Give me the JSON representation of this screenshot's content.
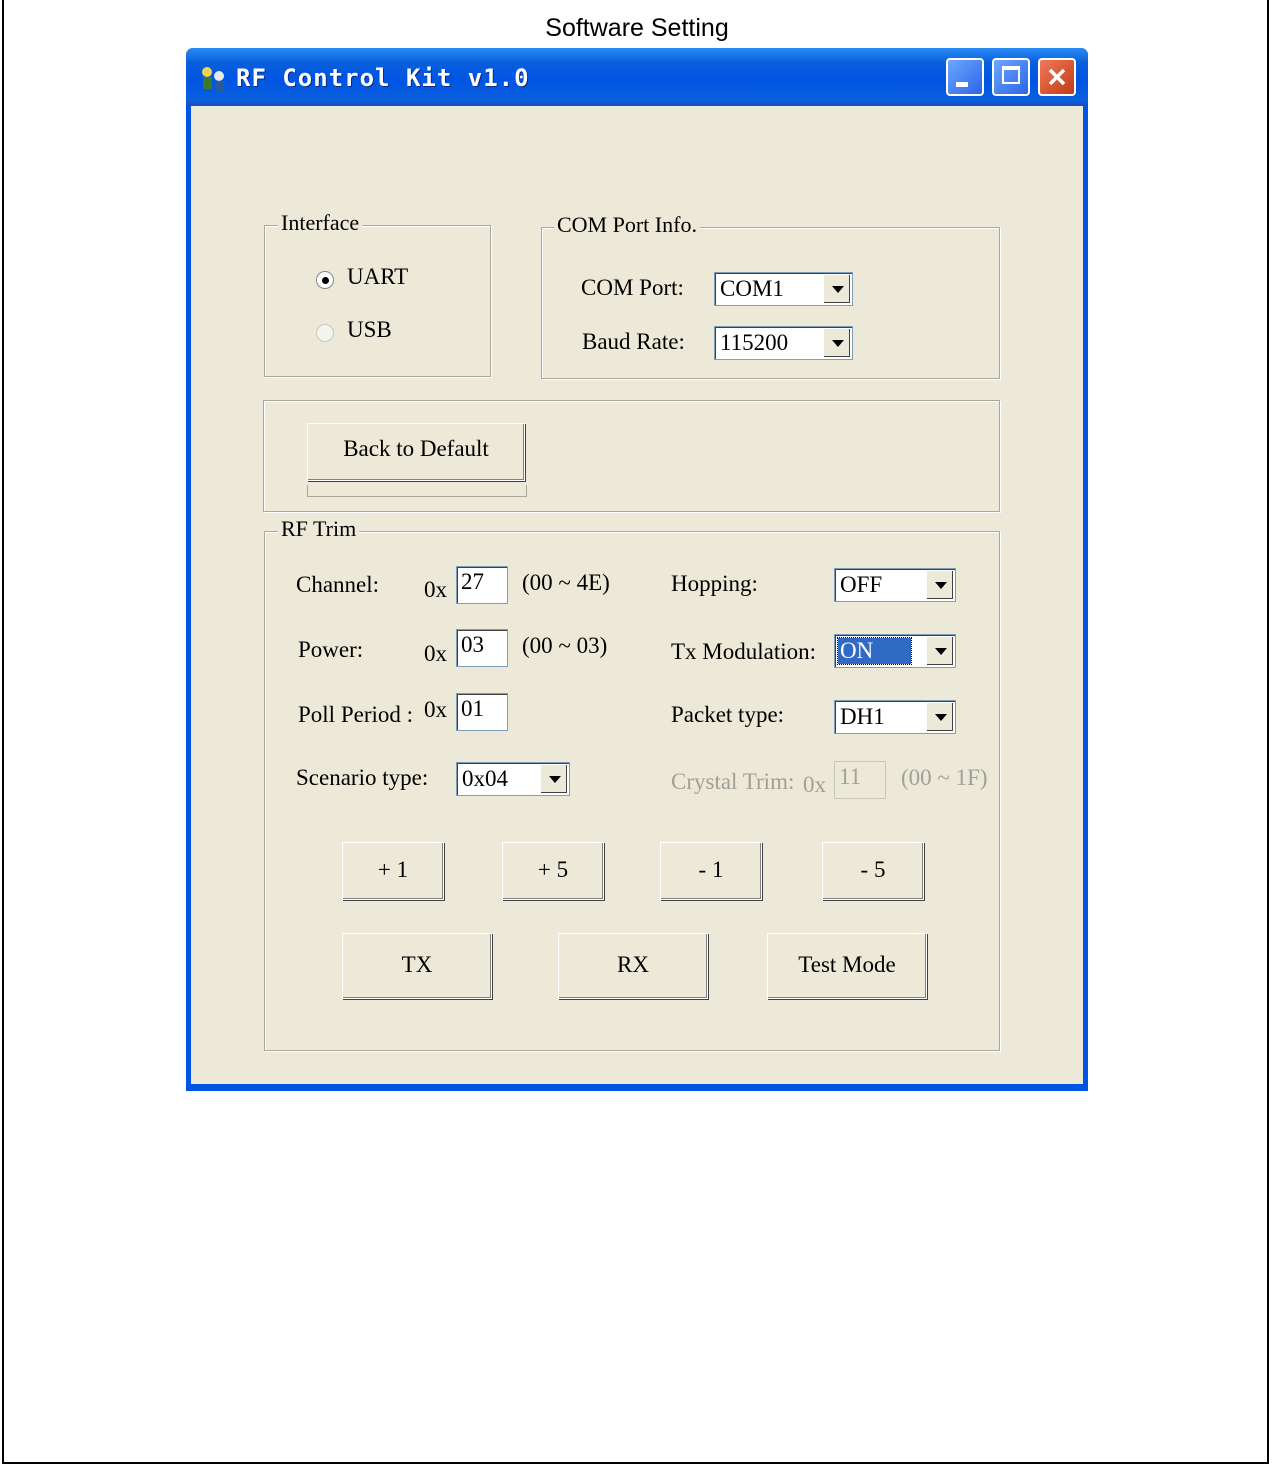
{
  "document": {
    "title": "Software Setting"
  },
  "window": {
    "title": "RF Control Kit v1.0",
    "icon": "rf-kit-icon",
    "controls": [
      "minimize-icon",
      "maximize-icon",
      "close-icon"
    ]
  },
  "interface_group": {
    "legend": "Interface",
    "options": [
      {
        "label": "UART",
        "selected": true
      },
      {
        "label": "USB",
        "selected": false
      }
    ]
  },
  "com_group": {
    "legend": "COM Port Info.",
    "com_port_label": "COM Port:",
    "com_port_value": "COM1",
    "baud_rate_label": "Baud Rate:",
    "baud_rate_value": "115200"
  },
  "default_group": {
    "button": "Back to Default"
  },
  "rf_trim": {
    "legend": "RF Trim",
    "channel": {
      "label": "Channel:",
      "prefix": "0x",
      "value": "27",
      "range": "(00 ~ 4E)"
    },
    "power": {
      "label": "Power:",
      "prefix": "0x",
      "value": "03",
      "range": "(00 ~ 03)"
    },
    "poll_period": {
      "label": "Poll Period :",
      "prefix": "0x",
      "value": "01"
    },
    "scenario_type": {
      "label": "Scenario type:",
      "value": "0x04"
    },
    "hopping": {
      "label": "Hopping:",
      "value": "OFF"
    },
    "tx_modulation": {
      "label": "Tx Modulation:",
      "value": "ON"
    },
    "packet_type": {
      "label": "Packet type:",
      "value": "DH1"
    },
    "crystal_trim": {
      "label": "Crystal Trim:",
      "prefix": "0x",
      "value": "11",
      "range": "(00 ~ 1F)"
    },
    "step_buttons": [
      "+ 1",
      "+ 5",
      "- 1",
      "- 5"
    ],
    "action_buttons": [
      "TX",
      "RX",
      "Test Mode"
    ]
  },
  "colors": {
    "title_bar": "#0054e3",
    "dialog_bg": "#ece9d8",
    "selection": "#316ac5",
    "close_button": "#c23a15"
  }
}
